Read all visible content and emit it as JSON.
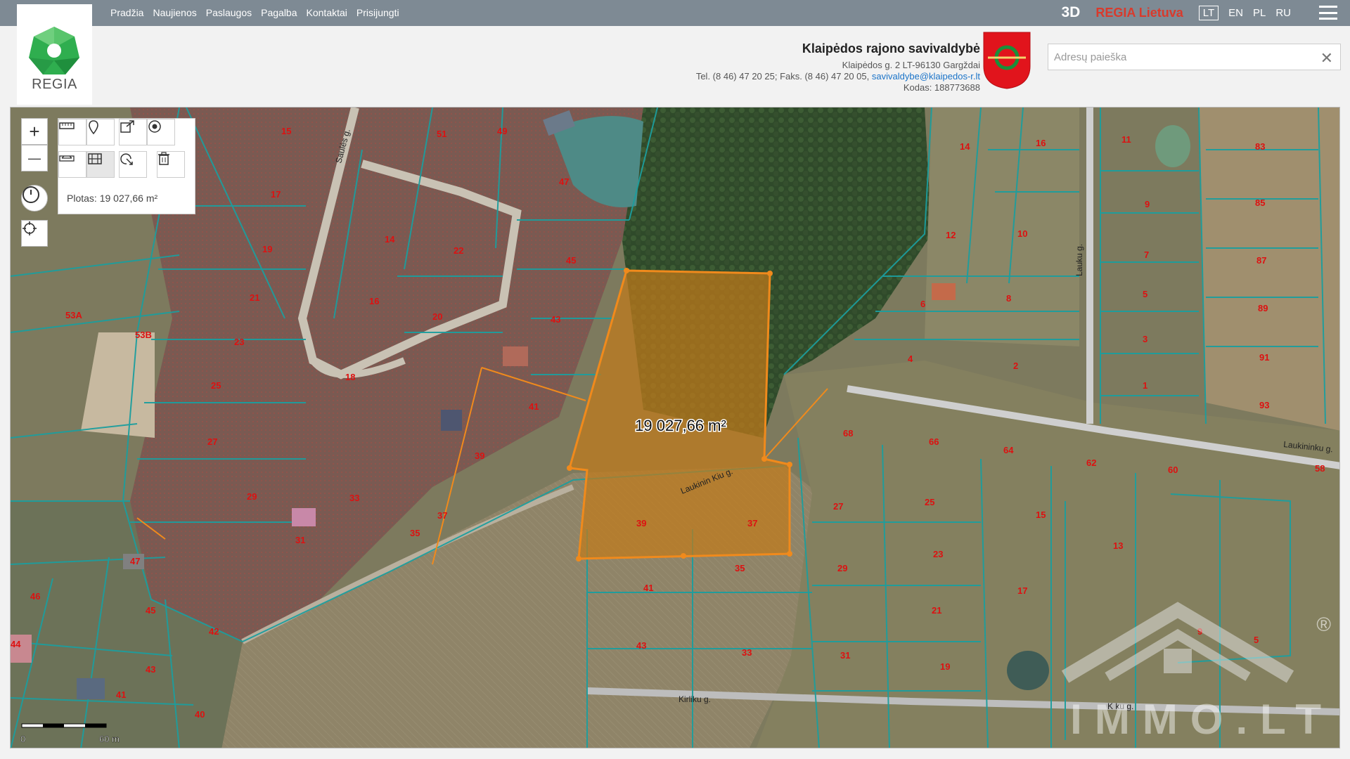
{
  "nav": {
    "items": [
      "Pradžia",
      "Naujienos",
      "Paslaugos",
      "Pagalba",
      "Kontaktai",
      "Prisijungti"
    ],
    "btn_3d": "3D",
    "brand": "REGIA Lietuva",
    "langs": [
      "LT",
      "EN",
      "PL",
      "RU"
    ],
    "active_lang": "LT"
  },
  "header": {
    "logo_text": "REGIA",
    "municipality": "Klaipėdos rajono savivaldybė",
    "address": "Klaipėdos g. 2 LT-96130 Gargždai",
    "phones": "Tel. (8 46) 47 20 25; Faks. (8 46) 47 20 05,",
    "email": "savivaldybe@klaipedos-r.lt",
    "code": "Kodas: 188773688",
    "search_placeholder": "Adresų paieška",
    "search_clear": "✕"
  },
  "map": {
    "area_readout": "Plotas: 19 027,66 m²",
    "polygon_label": "19 027,66 m²",
    "scale_zero": "0",
    "scale_label": "60 m",
    "watermark": "IMMO.LT",
    "watermark_mark": "®",
    "streets": [
      "Saulės g.",
      "Lauku g.",
      "Laukininku g.",
      "Laukinin Kiu g.",
      "Kirliku g.",
      "K ku g."
    ],
    "parcel_numbers": [
      "15",
      "17",
      "19",
      "21",
      "23",
      "25",
      "27",
      "29",
      "31",
      "33",
      "35",
      "37",
      "39",
      "41",
      "43",
      "45",
      "47",
      "49",
      "51",
      "53A",
      "53B",
      "14",
      "16",
      "18",
      "20",
      "22",
      "45",
      "43",
      "41",
      "39",
      "37",
      "35",
      "33",
      "31",
      "47",
      "46",
      "45",
      "44",
      "42",
      "43",
      "41",
      "40",
      "11",
      "16",
      "14",
      "12",
      "10",
      "8",
      "6",
      "4",
      "2",
      "9",
      "7",
      "5",
      "3",
      "1",
      "83",
      "85",
      "87",
      "89",
      "91",
      "93",
      "68",
      "66",
      "64",
      "62",
      "60",
      "58",
      "27",
      "25",
      "29",
      "23",
      "21",
      "19",
      "17",
      "15",
      "13",
      "9",
      "5",
      "35",
      "39",
      "37",
      "41",
      "43",
      "33",
      "31"
    ],
    "colors": {
      "parcel_lines": "#1c9e9e",
      "selection": "#f08a1c",
      "selection_fill": "#c07a1a",
      "parcel_text": "#dd1111"
    }
  },
  "controls": {
    "zoom_in": "+",
    "zoom_out": "—"
  }
}
